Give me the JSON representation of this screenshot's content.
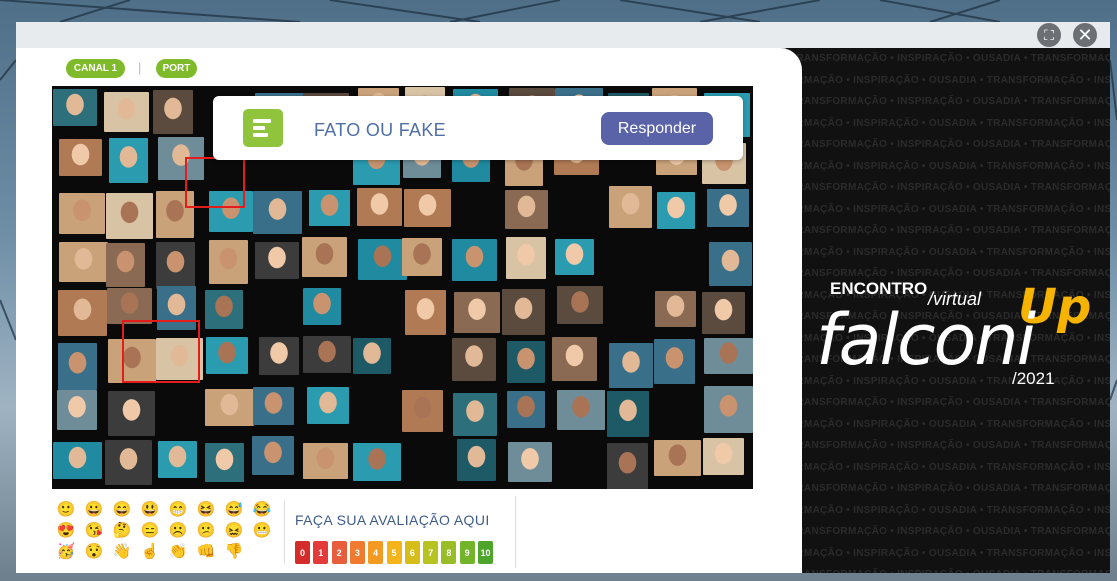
{
  "window": {
    "fullscreen_icon": "fullscreen-icon",
    "close_icon": "close-icon",
    "close_glyph": "✕",
    "fullscreen_glyph": "⛶"
  },
  "channels": {
    "canal": "CANAL 1",
    "separator": "|",
    "lang": "PORT"
  },
  "quiz": {
    "title": "FATO OU FAKE",
    "button": "Responder",
    "icon": "poll-icon"
  },
  "reactions": [
    "🙂",
    "😀",
    "😄",
    "😃",
    "😁",
    "😆",
    "😅",
    "😂",
    "😍",
    "😘",
    "🤔",
    "😑",
    "☹️",
    "😕",
    "😖",
    "😬",
    "🥳",
    "😯",
    "👋",
    "☝️",
    "👏",
    "👊",
    "👎"
  ],
  "rating": {
    "title": "FAÇA SUA AVALIAÇÃO AQUI",
    "scale": [
      {
        "label": "0",
        "color": "#d42b2b"
      },
      {
        "label": "1",
        "color": "#e43a3a"
      },
      {
        "label": "2",
        "color": "#e85d3c"
      },
      {
        "label": "3",
        "color": "#ef7a30"
      },
      {
        "label": "4",
        "color": "#f29a22"
      },
      {
        "label": "5",
        "color": "#f5b51a"
      },
      {
        "label": "6",
        "color": "#d6bd19"
      },
      {
        "label": "7",
        "color": "#b6c321"
      },
      {
        "label": "8",
        "color": "#98bd26"
      },
      {
        "label": "9",
        "color": "#72b52a"
      },
      {
        "label": "10",
        "color": "#4da52c"
      }
    ]
  },
  "brand": {
    "encontro": "ENCONTRO",
    "virtual": "/virtual",
    "name": "falconi",
    "up": "Up",
    "year": "/2021",
    "tagline": "TRANSFORMAÇÃO • INSPIRAÇÃO • OUSADIA • "
  },
  "colors": {
    "accent_green": "#7fba2b",
    "button_purple": "#5a63a8",
    "brand_gold": "#f6b400"
  }
}
